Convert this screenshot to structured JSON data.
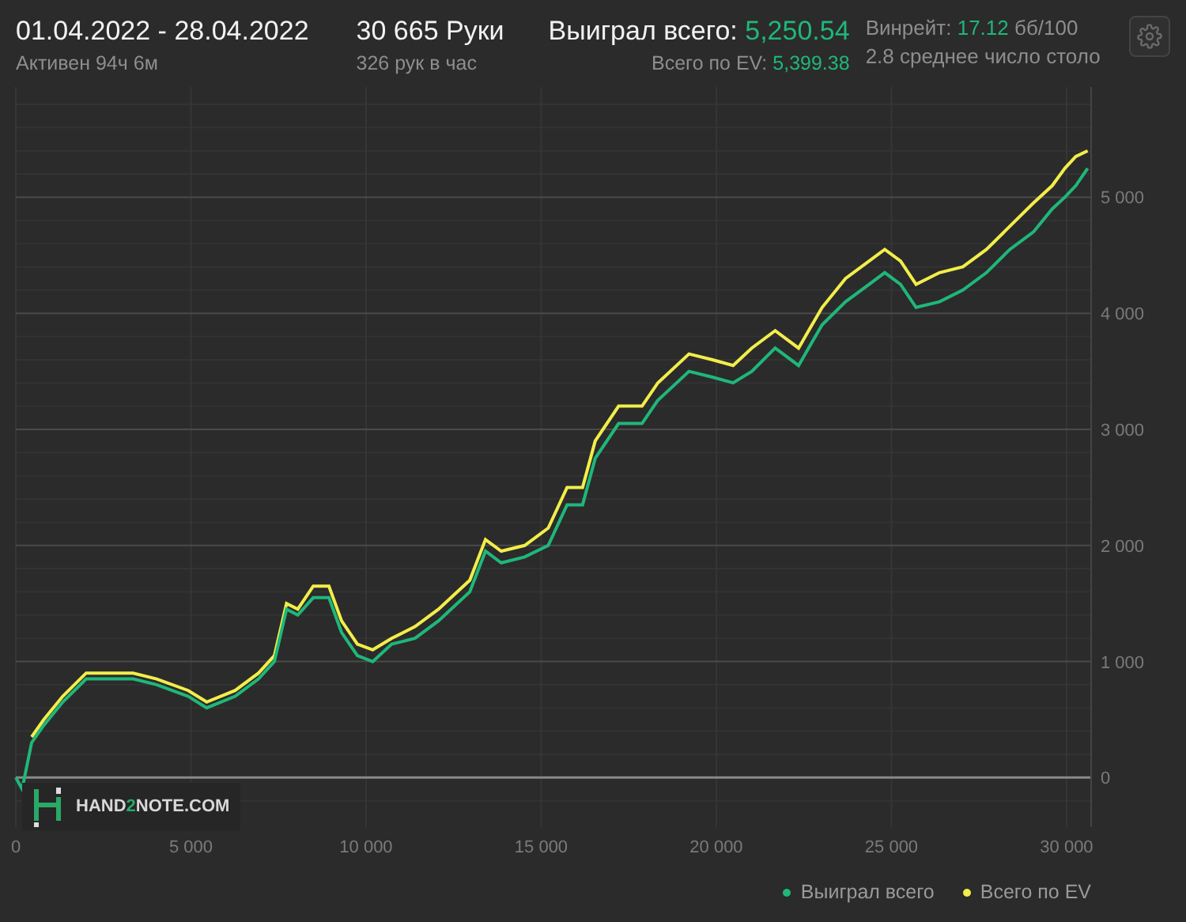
{
  "header": {
    "period": "01.04.2022 - 28.04.2022",
    "active": "Активен 94ч 6м",
    "hands": "30 665 Руки",
    "hands_rate": "326 рук в час",
    "won_label": "Выиграл всего:",
    "won_value": "5,250.54",
    "ev_label": "Всего по EV:",
    "ev_value": "5,399.38",
    "winrate_label": "Винрейт:",
    "winrate_value": "17.12",
    "winrate_unit": "бб/100",
    "avg_tables": "2.8 среднее число столо"
  },
  "watermark": {
    "prefix": "HAND",
    "accent": "2",
    "suffix": "NOTE.COM"
  },
  "chart_data": {
    "type": "line",
    "grid": true,
    "xlim": [
      0,
      30700
    ],
    "ylim": [
      -400,
      5950
    ],
    "xticks": [
      {
        "value": 0,
        "label": "0"
      },
      {
        "value": 5000,
        "label": "5 000"
      },
      {
        "value": 10000,
        "label": "10 000"
      },
      {
        "value": 15000,
        "label": "15 000"
      },
      {
        "value": 20000,
        "label": "20 000"
      },
      {
        "value": 25000,
        "label": "25 000"
      },
      {
        "value": 30000,
        "label": "30 000"
      }
    ],
    "yticks": [
      {
        "value": 0,
        "label": "0"
      },
      {
        "value": 1000,
        "label": "1 000"
      },
      {
        "value": 2000,
        "label": "2 000"
      },
      {
        "value": 3000,
        "label": "3 000"
      },
      {
        "value": 4000,
        "label": "4 000"
      },
      {
        "value": 5000,
        "label": "5 000"
      }
    ],
    "x": [
      0,
      180,
      450,
      800,
      1340,
      2010,
      2680,
      3350,
      4020,
      4920,
      5450,
      6260,
      6930,
      7380,
      7730,
      8050,
      8490,
      8940,
      9300,
      9750,
      10190,
      10730,
      11400,
      12070,
      12960,
      13410,
      13860,
      14530,
      15200,
      15740,
      16180,
      16540,
      17210,
      17880,
      18330,
      19220,
      19890,
      20480,
      21010,
      21680,
      22350,
      23020,
      23690,
      24360,
      24810,
      25260,
      25700,
      26370,
      27040,
      27710,
      28380,
      29050,
      29590,
      29950,
      30260,
      30600
    ],
    "series": [
      {
        "name": "Выиграл всего",
        "color": "#1fb77a",
        "values": [
          0,
          -100,
          300,
          450,
          650,
          850,
          850,
          850,
          800,
          700,
          600,
          700,
          850,
          1000,
          1450,
          1400,
          1550,
          1550,
          1250,
          1050,
          1000,
          1150,
          1200,
          1350,
          1600,
          1950,
          1850,
          1900,
          2000,
          2350,
          2350,
          2750,
          3050,
          3050,
          3250,
          3500,
          3450,
          3400,
          3500,
          3700,
          3550,
          3900,
          4100,
          4250,
          4350,
          4250,
          4050,
          4100,
          4200,
          4350,
          4550,
          4700,
          4900,
          5000,
          5100,
          5250
        ]
      },
      {
        "name": "Всего по EV",
        "color": "#f2ee4a",
        "values": [
          null,
          null,
          350,
          500,
          700,
          900,
          900,
          900,
          850,
          750,
          650,
          750,
          900,
          1050,
          1500,
          1450,
          1650,
          1650,
          1350,
          1150,
          1100,
          1200,
          1300,
          1450,
          1700,
          2050,
          1950,
          2000,
          2150,
          2500,
          2500,
          2900,
          3200,
          3200,
          3400,
          3650,
          3600,
          3550,
          3700,
          3850,
          3700,
          4050,
          4300,
          4450,
          4550,
          4450,
          4250,
          4350,
          4400,
          4550,
          4750,
          4950,
          5100,
          5250,
          5350,
          5400
        ]
      }
    ]
  }
}
